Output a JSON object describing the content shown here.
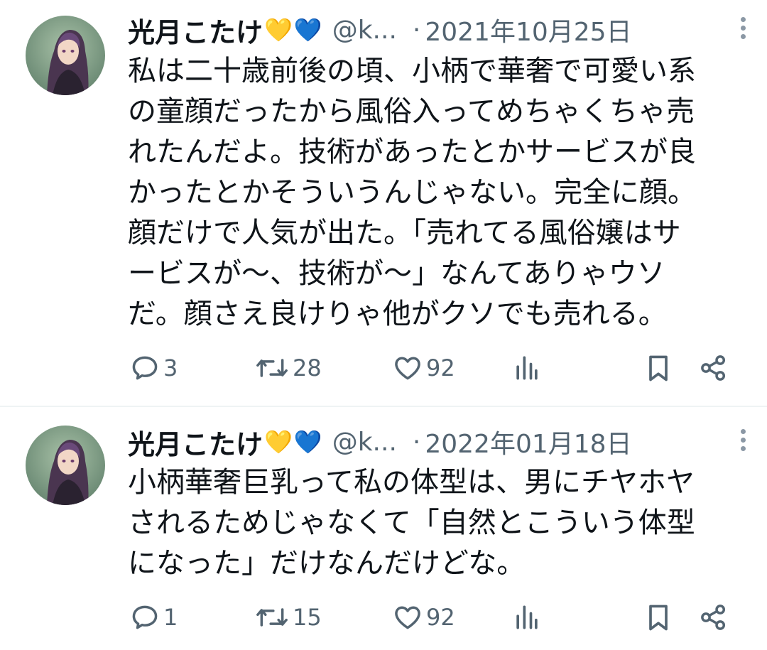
{
  "tweets": [
    {
      "author_name": "光月こたけ",
      "emojis": [
        "💛",
        "💙"
      ],
      "handle": "@k...",
      "separator": "·",
      "date": "2021年10月25日",
      "text": "私は二十歳前後の頃、小柄で華奢で可愛い系\nの童顔だったから風俗入ってめちゃくちゃ売\nれたんだよ。技術があったとかサービスが良\nかったとかそういうんじゃない。完全に顔。\n顔だけで人気が出た。「売れてる風俗嬢はサ\nービスが〜、技術が〜」なんてありゃウソ\nだ。顔さえ良けりゃ他がクソでも売れる。",
      "replies": "3",
      "retweets": "28",
      "likes": "92"
    },
    {
      "author_name": "光月こたけ",
      "emojis": [
        "💛",
        "💙"
      ],
      "handle": "@k...",
      "separator": "·",
      "date": "2022年01月18日",
      "text": "小柄華奢巨乳って私の体型は、男にチヤホヤ\nされるためじゃなくて「自然とこういう体型\nになった」だけなんだけどな。",
      "replies": "1",
      "retweets": "15",
      "likes": "92"
    }
  ],
  "icons": {
    "avatar": "avatar-image",
    "more": "more-vertical-icon",
    "reply": "reply-icon",
    "retweet": "retweet-icon",
    "like": "heart-icon",
    "views": "views-icon",
    "bookmark": "bookmark-icon",
    "share": "share-icon"
  },
  "colors": {
    "text_primary": "#0f1419",
    "text_secondary": "#536471",
    "divider": "#eff3f4",
    "heart_yellow": "#f7c51c",
    "heart_blue": "#1d6fe0"
  }
}
